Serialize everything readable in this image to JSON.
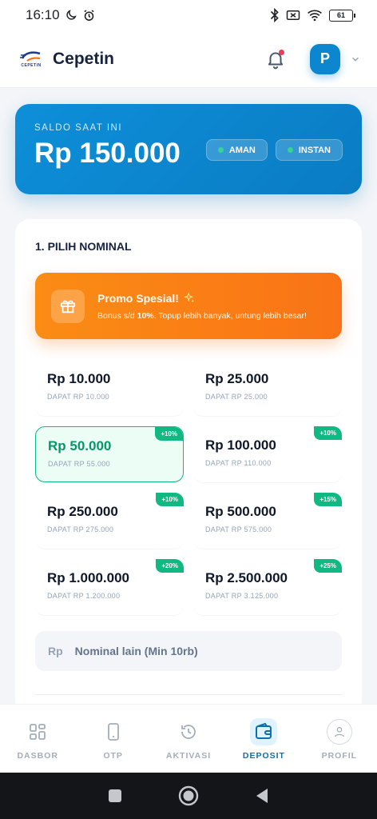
{
  "status_bar": {
    "time": "16:10",
    "battery": "61"
  },
  "app_bar": {
    "brand": "Cepetin",
    "logo_text": "CEPETIN",
    "avatar_initial": "P"
  },
  "balance": {
    "label": "SALDO SAAT INI",
    "amount": "Rp 150.000",
    "chips": [
      "AMAN",
      "INSTAN"
    ]
  },
  "section": {
    "title": "1. PILIH NOMINAL"
  },
  "promo": {
    "title": "Promo Spesial!",
    "subtitle_prefix": "Bonus s/d ",
    "subtitle_bold": "10%",
    "subtitle_suffix": ". Topup lebih banyak, untung lebih besar!"
  },
  "nominals": [
    {
      "amount": "Rp 10.000",
      "get": "DAPAT RP 10.000",
      "badge": ""
    },
    {
      "amount": "Rp 25.000",
      "get": "DAPAT RP 25.000",
      "badge": ""
    },
    {
      "amount": "Rp 50.000",
      "get": "DAPAT RP 55.000",
      "badge": "+10%",
      "selected": true
    },
    {
      "amount": "Rp 100.000",
      "get": "DAPAT RP 110.000",
      "badge": "+10%"
    },
    {
      "amount": "Rp 250.000",
      "get": "DAPAT RP 275.000",
      "badge": "+10%"
    },
    {
      "amount": "Rp 500.000",
      "get": "DAPAT RP 575.000",
      "badge": "+15%"
    },
    {
      "amount": "Rp 1.000.000",
      "get": "DAPAT RP 1.200.000",
      "badge": "+20%"
    },
    {
      "amount": "Rp 2.500.000",
      "get": "DAPAT RP 3.125.000",
      "badge": "+25%"
    }
  ],
  "custom_input": {
    "prefix": "Rp",
    "placeholder": "Nominal lain (Min 10rb)"
  },
  "bottom_nav": [
    {
      "label": "DASBOR",
      "icon": "grid-icon"
    },
    {
      "label": "OTP",
      "icon": "phone-icon"
    },
    {
      "label": "AKTIVASI",
      "icon": "history-icon"
    },
    {
      "label": "DEPOSIT",
      "icon": "wallet-icon",
      "active": true
    },
    {
      "label": "PROFIL",
      "icon": "user-icon"
    }
  ],
  "colors": {
    "primary": "#0b86cf",
    "success": "#10b981",
    "promo": "#f97316"
  }
}
